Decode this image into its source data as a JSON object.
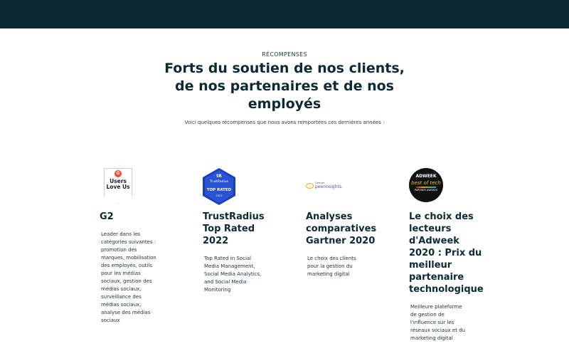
{
  "header": {
    "bar_color": "#0d2a33"
  },
  "section": {
    "eyebrow": "RÉCOMPENSES",
    "headline": "Forts du soutien de nos clients, de nos partenaires et de nos employés",
    "subline": "Voici quelques récompenses que nous avons remportées ces dernières années :"
  },
  "awards": [
    {
      "title": "G2",
      "description": "Leader dans les catégories suivantes : promotion des marques, mobilisation des employés, outils pour les médias sociaux, gestion des médias sociaux, surveillance des médias sociaux, analyse des médias sociaux",
      "badge": {
        "icon": "g2-users-love-us-badge",
        "letter": "G",
        "line1": "Users",
        "line2": "Love Us"
      }
    },
    {
      "title": "TrustRadius Top Rated 2022",
      "description": "Top Rated in Social Media Management, Social Media Analytics, and Social Media Monitoring",
      "badge": {
        "icon": "trustradius-top-rated-badge",
        "mark": "tR",
        "brand": "TrustRadius",
        "rated": "TOP RATED",
        "year": "2022"
      }
    },
    {
      "title": "Analyses comparatives Gartner 2020",
      "description": "Le choix des clients pour la gestion du marketing digital",
      "badge": {
        "icon": "gartner-peer-insights-logo",
        "small": "Gartner",
        "word": "peerinsights."
      }
    },
    {
      "title": "Le choix des lecteurs d'Adweek 2020 : Prix du meilleur partenaire technologique",
      "description": "Meilleure plateforme de gestion de l'influence sur les réseaux sociaux et du marketing digital",
      "badge": {
        "icon": "adweek-best-of-tech-badge",
        "top": "ADWEEK",
        "mid": "best of tech",
        "bot": "PARTNER AWARDS"
      }
    }
  ],
  "colors": {
    "heading": "#0b2a33",
    "g2_red": "#ff492c",
    "trustradius_blue": "#2a52d4",
    "adweek_gold": "#f2c12e"
  }
}
